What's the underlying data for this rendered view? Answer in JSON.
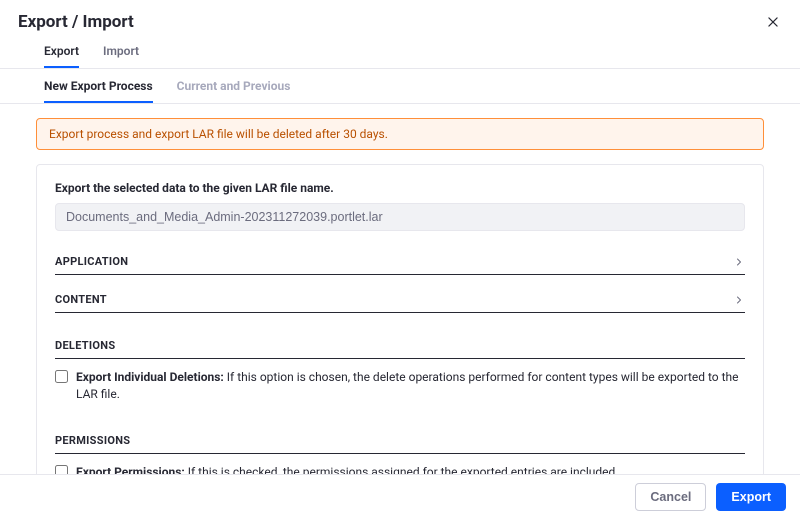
{
  "modal": {
    "title": "Export / Import"
  },
  "tabs_primary": {
    "export": "Export",
    "import": "Import"
  },
  "tabs_secondary": {
    "new_process": "New Export Process",
    "current_previous": "Current and Previous"
  },
  "alert": {
    "text": "Export process and export LAR file will be deleted after 30 days."
  },
  "panel": {
    "intro": "Export the selected data to the given LAR file name.",
    "filename": "Documents_and_Media_Admin-202311272039.portlet.lar"
  },
  "sections": {
    "application": "APPLICATION",
    "content": "CONTENT",
    "deletions": "DELETIONS",
    "permissions": "PERMISSIONS"
  },
  "deletions_row": {
    "label": "Export Individual Deletions:",
    "desc": "If this option is chosen, the delete operations performed for content types will be exported to the LAR file."
  },
  "permissions_row": {
    "label": "Export Permissions:",
    "desc": "If this is checked, the permissions assigned for the exported entries are included."
  },
  "footer": {
    "cancel": "Cancel",
    "export": "Export"
  }
}
